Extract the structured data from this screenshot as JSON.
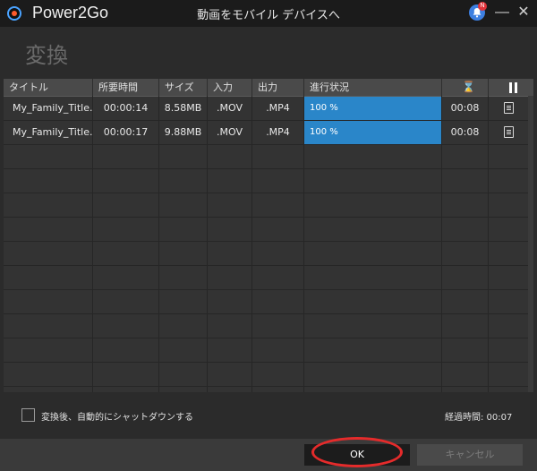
{
  "window": {
    "app_name": "Power2Go",
    "title": "動画をモバイル デバイスへ",
    "notification_badge": "N",
    "minimize_label": "—",
    "close_label": "✕"
  },
  "heading": "変換",
  "table": {
    "columns": [
      "タイトル",
      "所要時間",
      "サイズ",
      "入力",
      "出力",
      "進行状況"
    ],
    "hourglass_glyph": "⌛",
    "rows": [
      {
        "title": "My_Family_Title...",
        "duration": "00:00:14",
        "size": "8.58MB",
        "input": ".MOV",
        "output": ".MP4",
        "progress_label": "100 %",
        "progress": 100,
        "time": "00:08"
      },
      {
        "title": "My_Family_Title...",
        "duration": "00:00:17",
        "size": "9.88MB",
        "input": ".MOV",
        "output": ".MP4",
        "progress_label": "100 %",
        "progress": 100,
        "time": "00:08"
      }
    ]
  },
  "shutdown_checkbox": {
    "label": "変換後、自動的にシャットダウンする",
    "checked": false
  },
  "elapsed": "経過時間: 00:07",
  "buttons": {
    "ok": "OK",
    "cancel": "キャンセル"
  },
  "colors": {
    "progress_fill": "#2a86c9",
    "annotation": "#e52b2b"
  },
  "icons": [
    "power2go-logo-icon",
    "notification-bell-icon",
    "hourglass-icon",
    "pause-icon",
    "log-document-icon"
  ]
}
